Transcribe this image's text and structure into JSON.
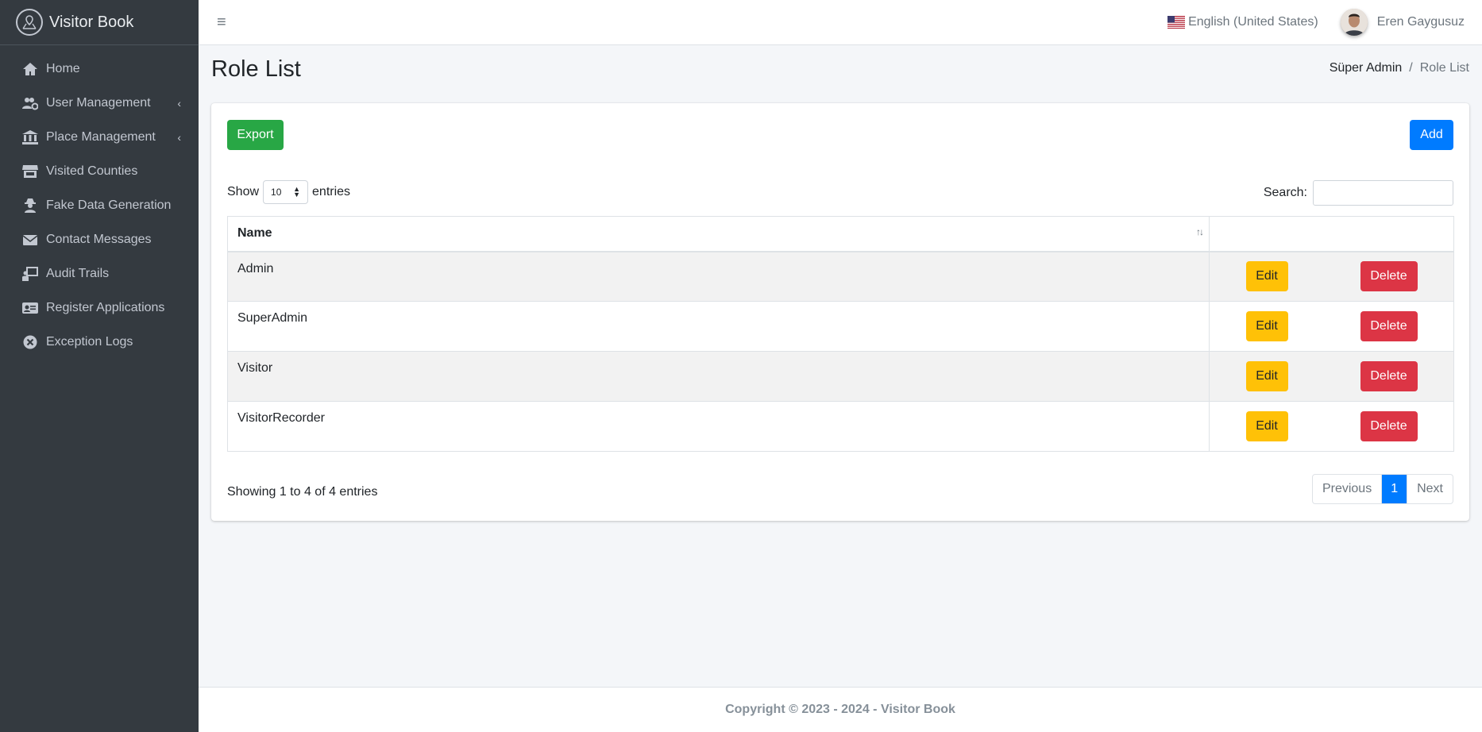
{
  "brand": {
    "name": "Visitor Book"
  },
  "sidebar": {
    "items": [
      {
        "label": "Home",
        "icon": "home-icon",
        "has_arrow": false
      },
      {
        "label": "User Management",
        "icon": "users-cog-icon",
        "has_arrow": true
      },
      {
        "label": "Place Management",
        "icon": "landmark-icon",
        "has_arrow": true
      },
      {
        "label": "Visited Counties",
        "icon": "store-icon",
        "has_arrow": false
      },
      {
        "label": "Fake Data Generation",
        "icon": "user-secret-icon",
        "has_arrow": false
      },
      {
        "label": "Contact Messages",
        "icon": "envelope-icon",
        "has_arrow": false
      },
      {
        "label": "Audit Trails",
        "icon": "chalkboard-teacher-icon",
        "has_arrow": false
      },
      {
        "label": "Register Applications",
        "icon": "id-card-icon",
        "has_arrow": false
      },
      {
        "label": "Exception Logs",
        "icon": "times-circle-icon",
        "has_arrow": false
      }
    ],
    "arrow": "‹"
  },
  "topbar": {
    "menu_icon": "≡",
    "language": "English (United States)",
    "user_name": "Eren Gaygusuz"
  },
  "page": {
    "title": "Role List",
    "breadcrumb": {
      "parent": "Süper Admin",
      "separator": "/",
      "current": "Role List"
    }
  },
  "toolbar": {
    "export_label": "Export",
    "add_label": "Add"
  },
  "table_controls": {
    "show_label": "Show",
    "entries_value": "10",
    "entries_label": "entries",
    "search_label": "Search:",
    "search_value": ""
  },
  "table": {
    "column_name": "Name",
    "rows": [
      {
        "name": "Admin",
        "edit": "Edit",
        "delete": "Delete"
      },
      {
        "name": "SuperAdmin",
        "edit": "Edit",
        "delete": "Delete"
      },
      {
        "name": "Visitor",
        "edit": "Edit",
        "delete": "Delete"
      },
      {
        "name": "VisitorRecorder",
        "edit": "Edit",
        "delete": "Delete"
      }
    ]
  },
  "pagination": {
    "info": "Showing 1 to 4 of 4 entries",
    "previous": "Previous",
    "current_page": "1",
    "next": "Next"
  },
  "footer": {
    "text": "Copyright © 2023 - 2024 - Visitor Book"
  },
  "colors": {
    "sidebar_bg": "#343a40",
    "export": "#28a745",
    "add": "#007bff",
    "edit": "#ffc107",
    "delete": "#dc3545"
  }
}
